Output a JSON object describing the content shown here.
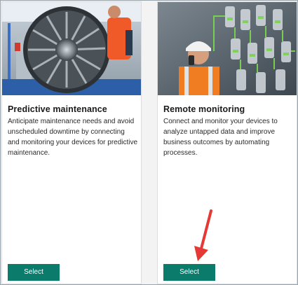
{
  "cards": [
    {
      "title": "Predictive maintenance",
      "description": "Anticipate maintenance needs and avoid unscheduled downtime by connecting and monitoring your devices for predictive maintenance.",
      "button_label": "Select",
      "image_icon": "jet-engine-photo"
    },
    {
      "title": "Remote monitoring",
      "description": "Connect and monitor your devices to analyze untapped data and improve business outcomes by automating processes.",
      "button_label": "Select",
      "image_icon": "control-room-photo"
    }
  ],
  "colors": {
    "button": "#0b7b6b",
    "annotation_arrow": "#e53935"
  }
}
